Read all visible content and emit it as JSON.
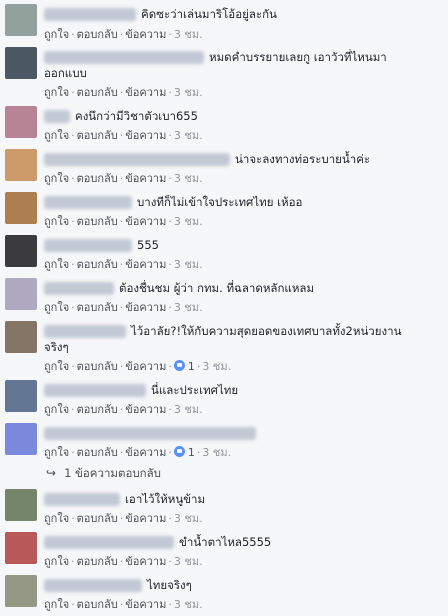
{
  "action_labels": {
    "like": "ถูกใจ",
    "reply": "ตอบกลับ",
    "message": "ข้อความ",
    "separator": "·"
  },
  "comments": [
    {
      "text": "คิดซะว่าเล่นมาริโอ้อยู่ละกัน",
      "time": "3 ชม.",
      "likes": "",
      "avatar_color": "#8a9a94"
    },
    {
      "text": "หมดคำบรรยายเลยกู เอาวัวที่ไหนมา",
      "text_line2": "ออกแบบ",
      "time": "3 ชม.",
      "likes": "",
      "avatar_color": "#3e4a58"
    },
    {
      "text": "คงนึกว่ามีวิชาตัวเบา655",
      "time": "3 ชม.",
      "likes": "",
      "avatar_color": "#b07a8c"
    },
    {
      "text": "น่าจะลงทางท่อระบายน้ำค่ะ",
      "time": "3 ชม.",
      "likes": "",
      "avatar_color": "#c9925e"
    },
    {
      "text": "บางทีก็ไม่เข้าใจประเทศไทย เห้ออ",
      "time": "3 ชม.",
      "likes": "",
      "avatar_color": "#a7733f"
    },
    {
      "text": "555",
      "time": "3 ชม.",
      "likes": "",
      "avatar_color": "#2b2b2d"
    },
    {
      "text": "ต้องชื่นชม ผู้ว่า กทม. ที่ฉลาดหลักแหลม",
      "time": "3 ชม.",
      "likes": "",
      "avatar_color": "#a9a2bd"
    },
    {
      "text": "ไว้อาลัย?!ให้กับความสุดยอดของเทศบาลทั้ง2หน่วยงาน",
      "text_line2": "จริงๆ",
      "time": "3 ชม.",
      "likes": "1",
      "avatar_color": "#7a6a5a"
    },
    {
      "text": "นี่และประเทศไทย",
      "time": "3 ชม.",
      "likes": "",
      "avatar_color": "#556b8a"
    },
    {
      "text": "",
      "time": "3 ชม.",
      "likes": "1",
      "avatar_color": "#6f7fd8"
    },
    {
      "text": "เอาไว้ให้หนูข้าม",
      "time": "3 ชม.",
      "likes": "",
      "avatar_color": "#6a7b5d"
    },
    {
      "text": "ขำน้ำตาไหล5555",
      "time": "3 ชม.",
      "likes": "",
      "avatar_color": "#b44a4a"
    },
    {
      "text": "ไทยจริงๆ",
      "time": "3 ชม.",
      "likes": "",
      "avatar_color": "#8a8f7a"
    }
  ],
  "replies": {
    "label": "1 ข้อความตอบกลับ"
  }
}
